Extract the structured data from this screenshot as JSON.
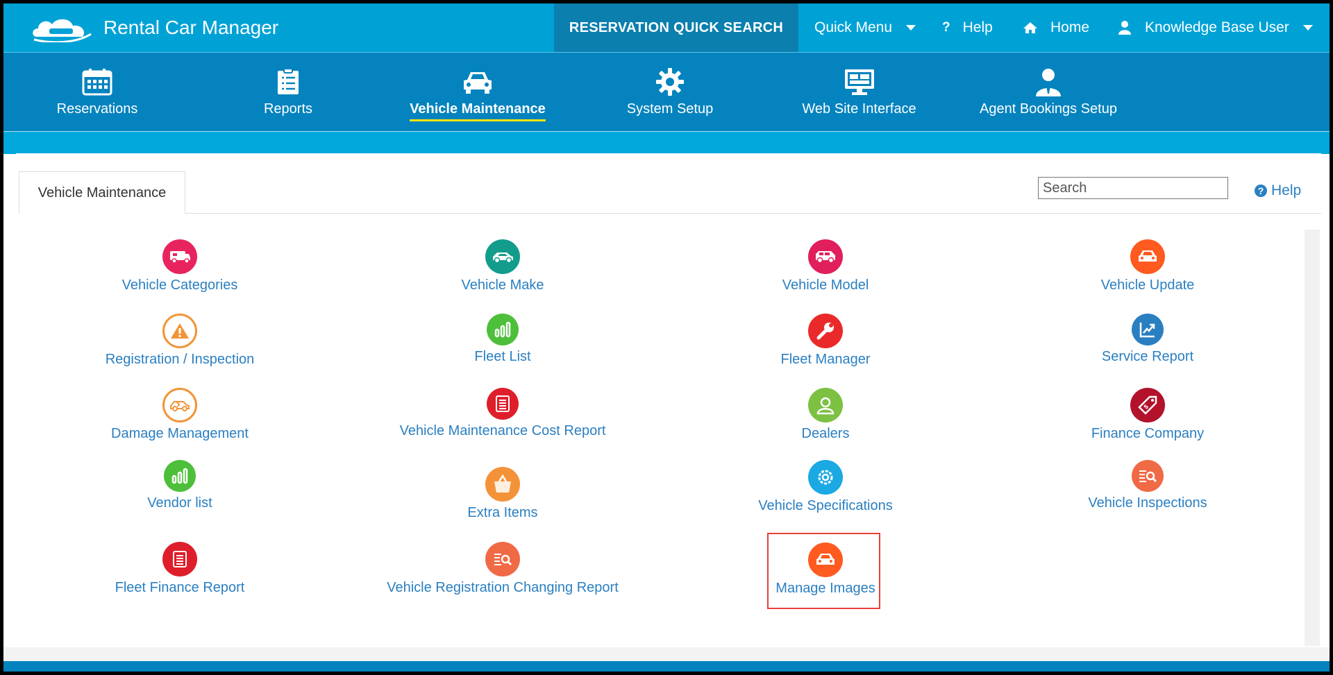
{
  "app": {
    "title": "Rental Car Manager"
  },
  "topbar": {
    "quick_search": "RESERVATION QUICK SEARCH",
    "quick_menu": "Quick Menu",
    "help": "Help",
    "home": "Home",
    "user": "Knowledge Base User"
  },
  "modules": [
    {
      "label": "Reservations",
      "icon": "calendar-icon"
    },
    {
      "label": "Reports",
      "icon": "checklist-icon"
    },
    {
      "label": "Vehicle Maintenance",
      "icon": "car-icon",
      "active": true
    },
    {
      "label": "System Setup",
      "icon": "gear-icon"
    },
    {
      "label": "Web Site Interface",
      "icon": "monitor-icon"
    },
    {
      "label": "Agent Bookings Setup",
      "icon": "agent-icon"
    }
  ],
  "page": {
    "tab": "Vehicle Maintenance",
    "search_placeholder": "Search",
    "help": "Help"
  },
  "items": [
    {
      "label": "Vehicle Categories",
      "color": "#e8245f",
      "icon": "rv-icon"
    },
    {
      "label": "Vehicle Make",
      "color": "#129c8c",
      "icon": "car-icon"
    },
    {
      "label": "Vehicle Model",
      "color": "#e01f5c",
      "icon": "van-icon"
    },
    {
      "label": "Vehicle Update",
      "color": "#ff5a1f",
      "icon": "car-front-icon"
    },
    {
      "label": "Registration / Inspection",
      "color": "#ffffff",
      "border": "#f29436",
      "icon": "warning-icon"
    },
    {
      "label": "Fleet List",
      "color": "#4dbf3a",
      "icon": "bar-chart-icon"
    },
    {
      "label": "Fleet Manager",
      "color": "#ea2a2a",
      "icon": "wrench-icon"
    },
    {
      "label": "Service Report",
      "color": "#2a7fc1",
      "icon": "trend-chart-icon"
    },
    {
      "label": "Damage Management",
      "color": "#ffffff",
      "border": "#f29436",
      "icon": "damaged-car-icon"
    },
    {
      "label": "Vehicle Maintenance Cost Report",
      "color": "#de1e2a",
      "icon": "document-icon"
    },
    {
      "label": "Dealers",
      "color": "#7cc142",
      "icon": "person-icon"
    },
    {
      "label": "Finance Company",
      "color": "#b3122b",
      "icon": "price-tag-icon"
    },
    {
      "label": "Vendor list",
      "color": "#4dbf3a",
      "icon": "bar-chart-icon"
    },
    {
      "label": "Extra Items",
      "color": "#f4923a",
      "icon": "basket-icon"
    },
    {
      "label": "Vehicle Specifications",
      "color": "#1ba9e3",
      "icon": "gear-icon"
    },
    {
      "label": "Vehicle Inspections",
      "color": "#f06a45",
      "icon": "list-search-icon"
    },
    {
      "label": "Fleet Finance Report",
      "color": "#de1e2a",
      "icon": "document-icon"
    },
    {
      "label": "Vehicle Registration Changing Report",
      "color": "#f06a45",
      "icon": "list-search-icon"
    },
    {
      "label": "Manage Images",
      "color": "#ff5a1f",
      "icon": "car-front-icon"
    }
  ],
  "colors": {
    "topbar": "#00a2d6",
    "modbar": "#0483be",
    "link": "#2a7fc1",
    "active_underline": "#ffe400",
    "highlight": "#e8403a"
  }
}
